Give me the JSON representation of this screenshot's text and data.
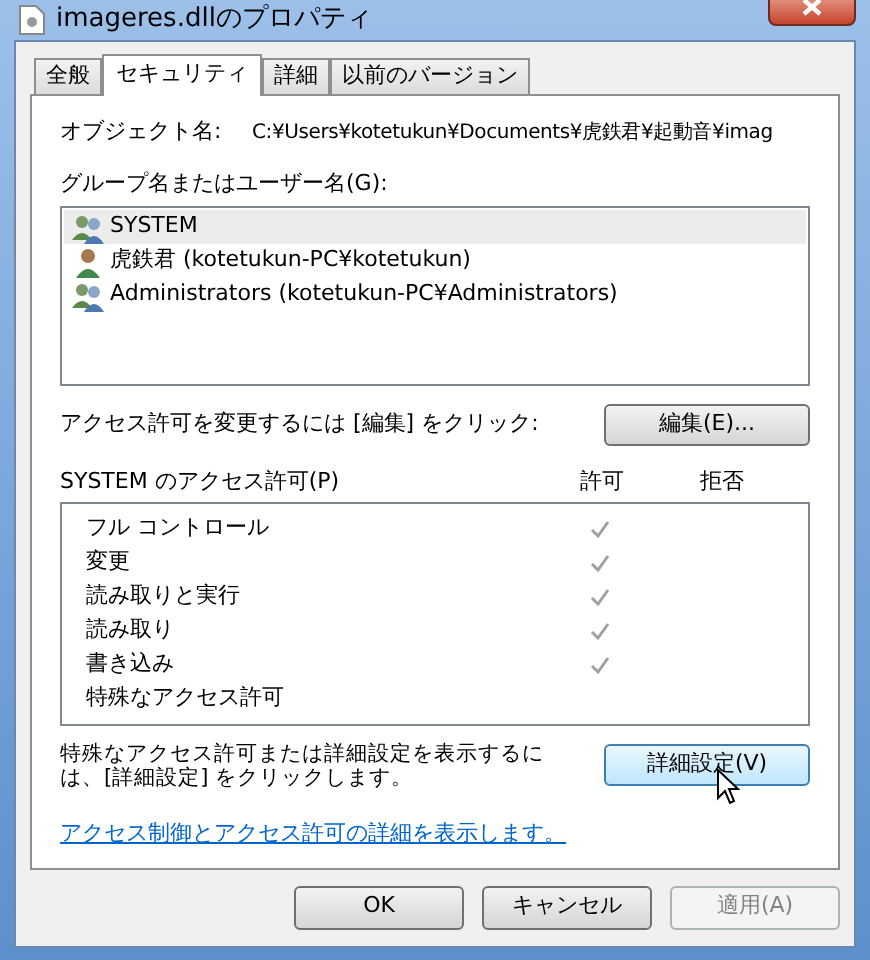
{
  "window": {
    "title": "imageres.dllのプロパティ"
  },
  "tabs": [
    {
      "label": "全般",
      "selected": false
    },
    {
      "label": "セキュリティ",
      "selected": true
    },
    {
      "label": "詳細",
      "selected": false
    },
    {
      "label": "以前のバージョン",
      "selected": false
    }
  ],
  "object_name": {
    "label": "オブジェクト名:",
    "value": "C:¥Users¥kotetukun¥Documents¥虎鉄君¥起動音¥imag"
  },
  "groups": {
    "label": "グループ名またはユーザー名(G):",
    "items": [
      {
        "name": "SYSTEM",
        "kind": "group",
        "selected": true
      },
      {
        "name": "虎鉄君 (kotetukun-PC¥kotetukun)",
        "kind": "user",
        "selected": false
      },
      {
        "name": "Administrators (kotetukun-PC¥Administrators)",
        "kind": "group",
        "selected": false
      }
    ]
  },
  "edit_hint": "アクセス許可を変更するには [編集] をクリック:",
  "edit_button": "編集(E)...",
  "permissions": {
    "label": "SYSTEM のアクセス許可(P)",
    "allow_header": "許可",
    "deny_header": "拒否",
    "items": [
      {
        "name": "フル コントロール",
        "allow": true,
        "deny": false
      },
      {
        "name": "変更",
        "allow": true,
        "deny": false
      },
      {
        "name": "読み取りと実行",
        "allow": true,
        "deny": false
      },
      {
        "name": "読み取り",
        "allow": true,
        "deny": false
      },
      {
        "name": "書き込み",
        "allow": true,
        "deny": false
      },
      {
        "name": "特殊なアクセス許可",
        "allow": false,
        "deny": false
      }
    ]
  },
  "advanced_hint": "特殊なアクセス許可または詳細設定を表示するには、[詳細設定] をクリックします。",
  "advanced_button": "詳細設定(V)",
  "help_link": "アクセス制御とアクセス許可の詳細を表示します。",
  "buttons": [
    {
      "label": "OK",
      "disabled": false
    },
    {
      "label": "キャンセル",
      "disabled": false
    },
    {
      "label": "適用(A)",
      "disabled": true
    }
  ]
}
